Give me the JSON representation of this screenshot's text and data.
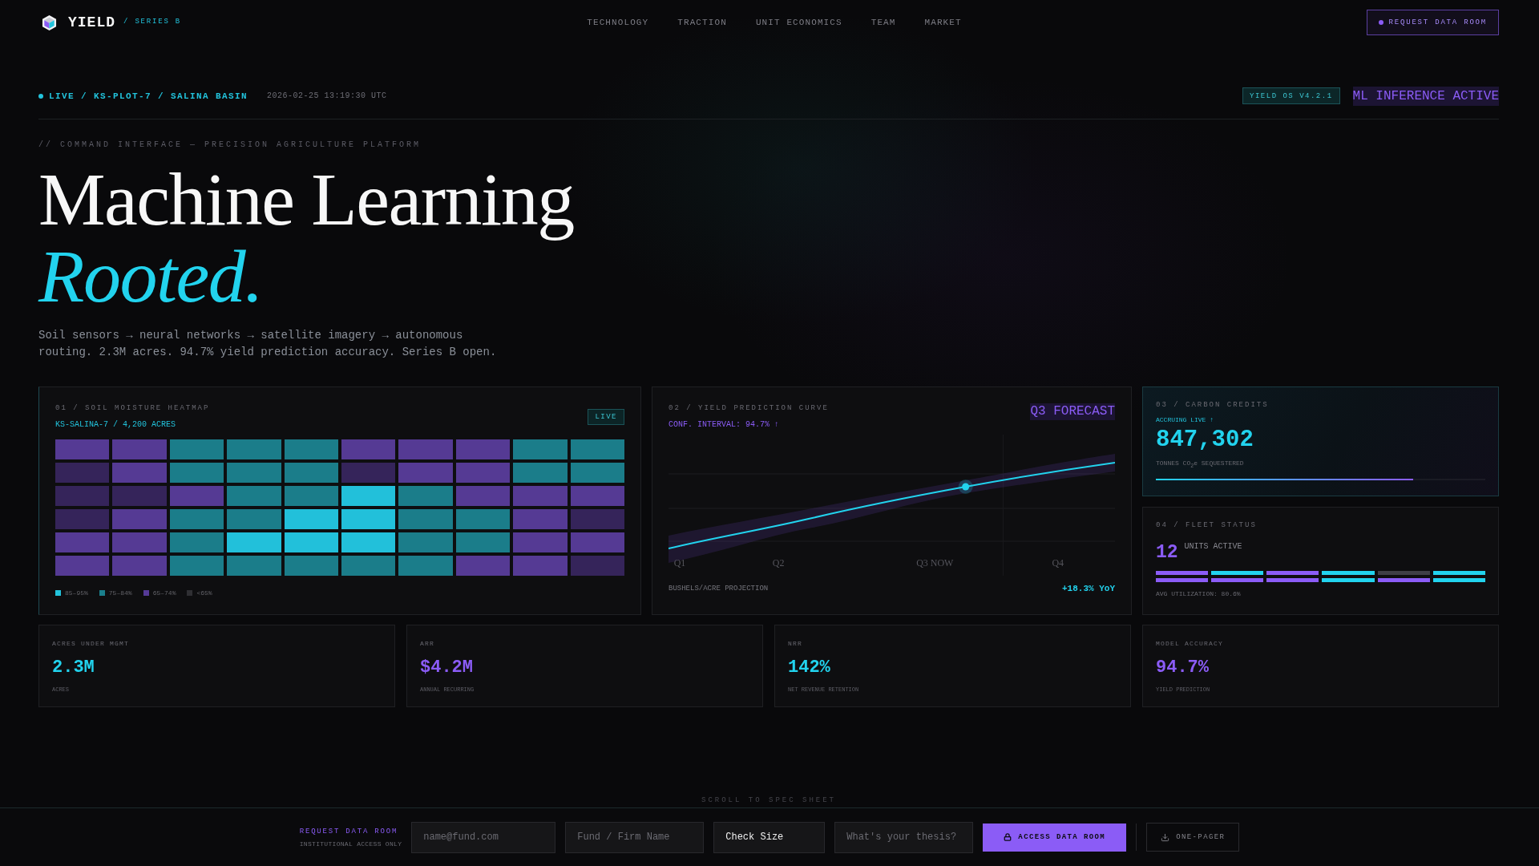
{
  "nav": {
    "logo": "YIELD",
    "tag": "/ SERIES B",
    "links": [
      "TECHNOLOGY",
      "TRACTION",
      "UNIT ECONOMICS",
      "TEAM",
      "MARKET"
    ],
    "cta": "REQUEST DATA ROOM"
  },
  "status_bar": {
    "location": "LIVE / KS-PLOT-7 / SALINA BASIN",
    "timestamp": "2026-02-25 13:19:30 UTC",
    "version": "YIELD OS V4.2.1",
    "inference": "ML INFERENCE ACTIVE"
  },
  "hero": {
    "eyebrow": "// COMMAND INTERFACE — PRECISION AGRICULTURE PLATFORM",
    "title": "Machine Learning",
    "title_accent": "Rooted.",
    "lede": "Soil sensors → neural networks → satellite imagery → autonomous routing. 2.3M acres. 94.7% yield prediction accuracy. Series B open."
  },
  "heatmap": {
    "title": "01 / SOIL MOISTURE HEATMAP",
    "subtitle": "KS-SALINA-7 / 4,200 ACRES",
    "badge": "LIVE",
    "rows": [
      [
        {
          "color": "#553a94"
        },
        {
          "color": "#553a94"
        },
        {
          "color": "#1b7d8a"
        },
        {
          "color": "#1b7d8a"
        },
        {
          "color": "#1b7d8a"
        },
        {
          "color": "#553a94"
        },
        {
          "color": "#553a94"
        },
        {
          "color": "#553a94"
        },
        {
          "color": "#1b7d8a"
        },
        {
          "color": "#1b7d8a"
        }
      ],
      [
        {
          "color": "#35245a"
        },
        {
          "color": "#553a94"
        },
        {
          "color": "#1b7d8a"
        },
        {
          "color": "#1b7d8a"
        },
        {
          "color": "#1b7d8a"
        },
        {
          "color": "#35245a"
        },
        {
          "color": "#553a94"
        },
        {
          "color": "#553a94"
        },
        {
          "color": "#1b7d8a"
        },
        {
          "color": "#1b7d8a"
        }
      ],
      [
        {
          "color": "#35245a"
        },
        {
          "color": "#35245a"
        },
        {
          "color": "#553a94"
        },
        {
          "color": "#1b7d8a"
        },
        {
          "color": "#1b7d8a"
        },
        {
          "color": "#22c0da"
        },
        {
          "color": "#1b7d8a"
        },
        {
          "color": "#553a94"
        },
        {
          "color": "#553a94"
        },
        {
          "color": "#553a94"
        }
      ],
      [
        {
          "color": "#35245a"
        },
        {
          "color": "#553a94"
        },
        {
          "color": "#1b7d8a"
        },
        {
          "color": "#1b7d8a"
        },
        {
          "color": "#22c0da"
        },
        {
          "color": "#22c0da"
        },
        {
          "color": "#1b7d8a"
        },
        {
          "color": "#1b7d8a"
        },
        {
          "color": "#553a94"
        },
        {
          "color": "#35245a"
        }
      ],
      [
        {
          "color": "#553a94"
        },
        {
          "color": "#553a94"
        },
        {
          "color": "#1b7d8a"
        },
        {
          "color": "#22c0da"
        },
        {
          "color": "#22c0da"
        },
        {
          "color": "#22c0da"
        },
        {
          "color": "#1b7d8a"
        },
        {
          "color": "#1b7d8a"
        },
        {
          "color": "#553a94"
        },
        {
          "color": "#553a94"
        }
      ],
      [
        {
          "color": "#553a94"
        },
        {
          "color": "#553a94"
        },
        {
          "color": "#1b7d8a"
        },
        {
          "color": "#1b7d8a"
        },
        {
          "color": "#1b7d8a"
        },
        {
          "color": "#1b7d8a"
        },
        {
          "color": "#1b7d8a"
        },
        {
          "color": "#553a94"
        },
        {
          "color": "#553a94"
        },
        {
          "color": "#35245a"
        }
      ]
    ],
    "legend": [
      {
        "label": "85–95%",
        "color": "#22c3dc"
      },
      {
        "label": "75–84%",
        "color": "#1a7f8c"
      },
      {
        "label": "65–74%",
        "color": "#553a96"
      },
      {
        "label": "<65%",
        "color": "#2f2f33"
      }
    ]
  },
  "yield_curve": {
    "title": "02 / YIELD PREDICTION CURVE",
    "subtitle": "CONF. INTERVAL: 94.7% ↑",
    "badge": "Q3 FORECAST",
    "x_labels": [
      "Q1",
      "Q2",
      "Q3 NOW",
      "Q4"
    ],
    "caption": "BUSHELS/ACRE PROJECTION",
    "change": "+18.3% YoY"
  },
  "carbon": {
    "title": "03 / CARBON CREDITS",
    "status": "ACCRUING LIVE ↑",
    "value": "847,302",
    "unit": "TONNES CO$_{2}$e SEQUESTERED",
    "level": 0.78
  },
  "fleet": {
    "title": "04 / FLEET STATUS",
    "count": "12",
    "count_label": "UNITS ACTIVE",
    "units": [
      {
        "color": "#8b5cf6"
      },
      {
        "color": "#22d3ee"
      },
      {
        "color": "#8b5cf6"
      },
      {
        "color": "#22d3ee"
      },
      {
        "color": "#3f3f46"
      },
      {
        "color": "#22d3ee"
      },
      {
        "color": "#8b5cf6"
      },
      {
        "color": "#8b5cf6"
      },
      {
        "color": "#8b5cf6"
      },
      {
        "color": "#22d3ee"
      },
      {
        "color": "#8b5cf6"
      },
      {
        "color": "#22d3ee"
      }
    ],
    "utilization": "AVG UTILIZATION: 80.6%"
  },
  "stats": [
    {
      "label": "ACRES UNDER MGMT",
      "value": "2.3M",
      "caption": "ACRES",
      "color": "#22d3ee"
    },
    {
      "label": "ARR",
      "value": "$4.2M",
      "caption": "ANNUAL RECURRING",
      "color": "#8b5cf6"
    },
    {
      "label": "NRR",
      "value": "142%",
      "caption": "NET REVENUE RETENTION",
      "color": "#22d3ee"
    },
    {
      "label": "MODEL ACCURACY",
      "value": "94.7%",
      "caption": "YIELD PREDICTION",
      "color": "#8b5cf6"
    }
  ],
  "scroll_hint": "SCROLL TO SPEC SHEET",
  "footer": {
    "title": "REQUEST DATA ROOM",
    "note": "INSTITUTIONAL ACCESS ONLY",
    "fields": [
      {
        "kind": "input",
        "placeholder": "name@fund.com"
      },
      {
        "kind": "input",
        "placeholder": "Fund / Firm Name"
      },
      {
        "kind": "select",
        "value": "Check Size"
      },
      {
        "kind": "input",
        "placeholder": "What's your thesis?"
      }
    ],
    "submit": "ACCESS DATA ROOM",
    "download": "ONE-PAGER"
  }
}
